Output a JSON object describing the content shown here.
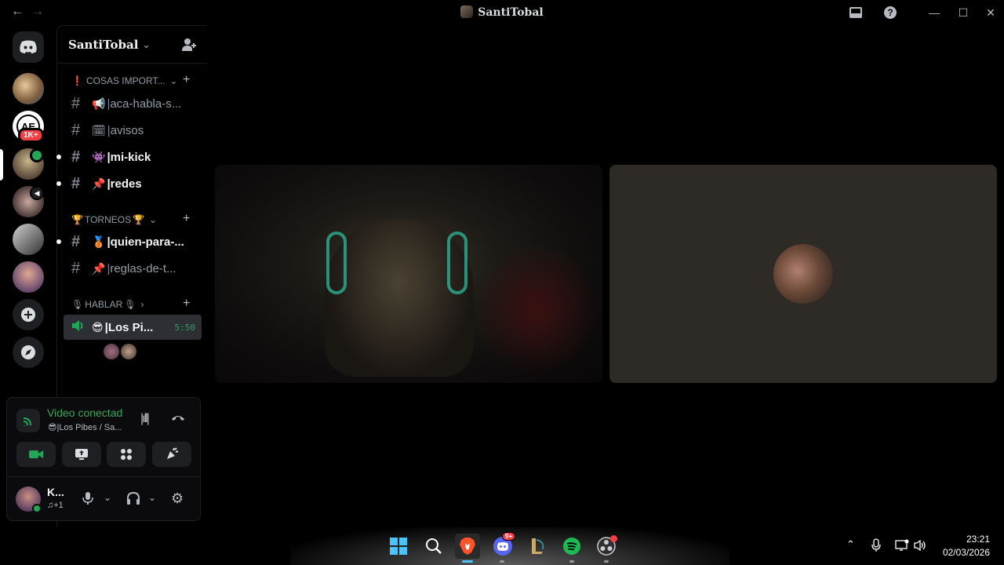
{
  "window": {
    "title": "SantiTobal"
  },
  "rail": {
    "badge_count": "1K+"
  },
  "server": {
    "name": "SantiTobal",
    "categories": [
      {
        "label": "COSAS IMPORT...",
        "icon": "❗"
      },
      {
        "label": "TORNEOS",
        "icon": "🏆"
      },
      {
        "label": "HABLAR",
        "icon": "🎙"
      }
    ],
    "channels": [
      {
        "emoji": "📢",
        "name": "aca-habla-s..."
      },
      {
        "emoji": "🗓",
        "name": "avisos"
      },
      {
        "emoji": "👾",
        "name": "mi-kick"
      },
      {
        "emoji": "📌",
        "name": "redes"
      },
      {
        "emoji": "🥉",
        "name": "quien-para-..."
      },
      {
        "emoji": "📌",
        "name": "reglas-de-t..."
      }
    ],
    "voice_channel": {
      "emoji": "😎",
      "name": "Los Pi...",
      "timer": "5:50"
    }
  },
  "voice_panel": {
    "status": "Video conectad",
    "location": "Los Pibes / Sa..."
  },
  "user": {
    "name": "K...",
    "activity": "♫+1"
  },
  "taskbar": {
    "discord_badge": "9+",
    "time": "23:21",
    "date": "02/03/2026"
  },
  "colors": {
    "accent_green": "#23a55a",
    "status_text_green": "#3ba55d",
    "badge_red": "#f23f43"
  }
}
